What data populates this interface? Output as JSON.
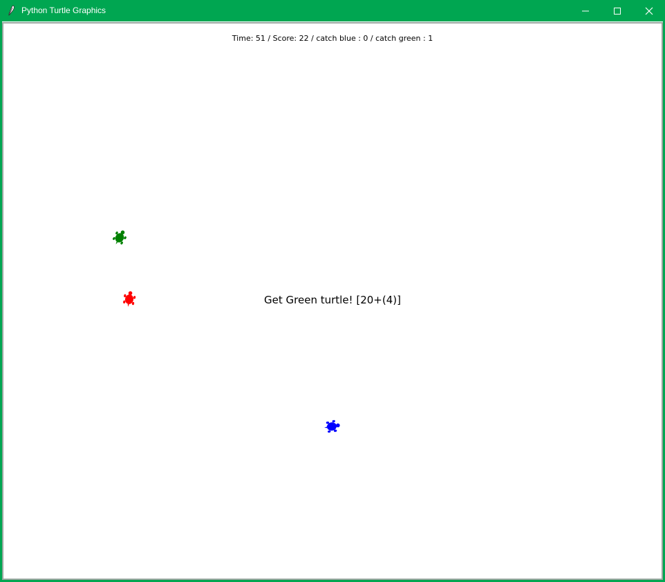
{
  "window": {
    "title": "Python Turtle Graphics",
    "accent_color": "#00a651"
  },
  "titlebar": {
    "icons": [
      "feather-icon",
      "minimize-icon",
      "maximize-icon",
      "close-icon"
    ]
  },
  "game": {
    "status": "Time: 51 / Score: 22 / catch blue : 0 / catch green : 1",
    "message": "Get Green turtle! [20+(4)]",
    "turtles": [
      {
        "name": "green-turtle",
        "color": "#008000"
      },
      {
        "name": "red-turtle",
        "color": "#ff0000"
      },
      {
        "name": "blue-turtle",
        "color": "#0000ff"
      }
    ]
  }
}
